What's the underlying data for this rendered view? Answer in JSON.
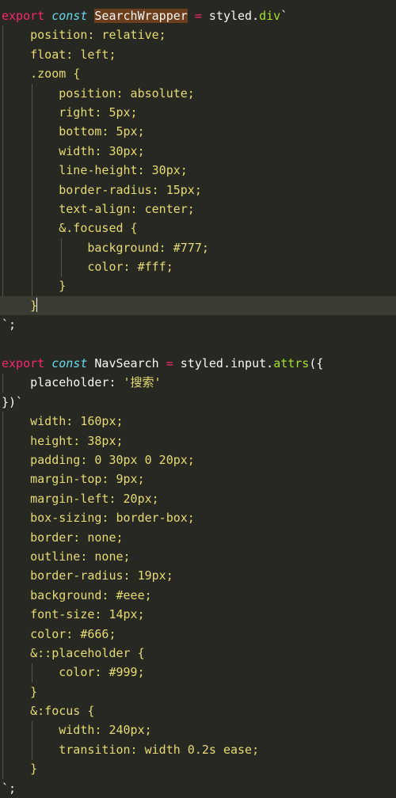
{
  "editor": {
    "theme_name": "monokai",
    "colors": {
      "background": "#272822",
      "active_line": "#3a3b32",
      "keyword": "#f92672",
      "storage": "#66d9ef",
      "string": "#e6db74",
      "function": "#a6e22e",
      "foreground": "#f8f8f2",
      "selection": "#6b3e1e",
      "indent_guide": "#55564f",
      "cursor": "#f8f8f0"
    },
    "cursor_line_index": 15,
    "indent_size": 4,
    "language": "javascript"
  },
  "code": {
    "lines": [
      {
        "indent": 0,
        "active": false,
        "tokens": [
          {
            "t": "export",
            "c": "k"
          },
          {
            "t": " ",
            "c": "pun"
          },
          {
            "t": "const",
            "c": "kc"
          },
          {
            "t": " ",
            "c": "pun"
          },
          {
            "t": "SearchWrapper",
            "c": "sel"
          },
          {
            "t": " ",
            "c": "pun"
          },
          {
            "t": "=",
            "c": "k"
          },
          {
            "t": " ",
            "c": "pun"
          },
          {
            "t": "styled.",
            "c": "id"
          },
          {
            "t": "div",
            "c": "fn"
          },
          {
            "t": "`",
            "c": "pun"
          }
        ]
      },
      {
        "indent": 1,
        "active": false,
        "tokens": [
          {
            "t": "position: relative;",
            "c": "pr"
          }
        ]
      },
      {
        "indent": 1,
        "active": false,
        "tokens": [
          {
            "t": "float: left;",
            "c": "pr"
          }
        ]
      },
      {
        "indent": 1,
        "active": false,
        "tokens": [
          {
            "t": ".zoom {",
            "c": "pr"
          }
        ]
      },
      {
        "indent": 2,
        "active": false,
        "tokens": [
          {
            "t": "position: absolute;",
            "c": "pr"
          }
        ]
      },
      {
        "indent": 2,
        "active": false,
        "tokens": [
          {
            "t": "right: 5px;",
            "c": "pr"
          }
        ]
      },
      {
        "indent": 2,
        "active": false,
        "tokens": [
          {
            "t": "bottom: 5px;",
            "c": "pr"
          }
        ]
      },
      {
        "indent": 2,
        "active": false,
        "tokens": [
          {
            "t": "width: 30px;",
            "c": "pr"
          }
        ]
      },
      {
        "indent": 2,
        "active": false,
        "tokens": [
          {
            "t": "line-height: 30px;",
            "c": "pr"
          }
        ]
      },
      {
        "indent": 2,
        "active": false,
        "tokens": [
          {
            "t": "border-radius: 15px;",
            "c": "pr"
          }
        ]
      },
      {
        "indent": 2,
        "active": false,
        "tokens": [
          {
            "t": "text-align: center;",
            "c": "pr"
          }
        ]
      },
      {
        "indent": 2,
        "active": false,
        "tokens": [
          {
            "t": "&.focused {",
            "c": "pr"
          }
        ]
      },
      {
        "indent": 3,
        "active": false,
        "tokens": [
          {
            "t": "background: #777;",
            "c": "pr"
          }
        ]
      },
      {
        "indent": 3,
        "active": false,
        "tokens": [
          {
            "t": "color: #fff;",
            "c": "pr"
          }
        ]
      },
      {
        "indent": 2,
        "active": false,
        "tokens": [
          {
            "t": "}",
            "c": "pr"
          }
        ]
      },
      {
        "indent": 1,
        "active": true,
        "cursor": true,
        "tokens": [
          {
            "t": "}",
            "c": "pr"
          }
        ]
      },
      {
        "indent": 0,
        "active": false,
        "tokens": [
          {
            "t": "`;",
            "c": "pun"
          }
        ]
      },
      {
        "indent": 0,
        "active": false,
        "tokens": []
      },
      {
        "indent": 0,
        "active": false,
        "tokens": [
          {
            "t": "export",
            "c": "k"
          },
          {
            "t": " ",
            "c": "pun"
          },
          {
            "t": "const",
            "c": "kc"
          },
          {
            "t": " ",
            "c": "pun"
          },
          {
            "t": "NavSearch",
            "c": "id"
          },
          {
            "t": " ",
            "c": "pun"
          },
          {
            "t": "=",
            "c": "k"
          },
          {
            "t": " ",
            "c": "pun"
          },
          {
            "t": "styled.input.",
            "c": "id"
          },
          {
            "t": "attrs",
            "c": "fn"
          },
          {
            "t": "({",
            "c": "pun"
          }
        ]
      },
      {
        "indent": 1,
        "active": false,
        "tokens": [
          {
            "t": "placeholder: ",
            "c": "id"
          },
          {
            "t": "'搜索'",
            "c": "pr"
          }
        ]
      },
      {
        "indent": 0,
        "active": false,
        "tokens": [
          {
            "t": "})`",
            "c": "pun"
          }
        ]
      },
      {
        "indent": 1,
        "active": false,
        "tokens": [
          {
            "t": "width: 160px;",
            "c": "pr"
          }
        ]
      },
      {
        "indent": 1,
        "active": false,
        "tokens": [
          {
            "t": "height: 38px;",
            "c": "pr"
          }
        ]
      },
      {
        "indent": 1,
        "active": false,
        "tokens": [
          {
            "t": "padding: 0 30px 0 20px;",
            "c": "pr"
          }
        ]
      },
      {
        "indent": 1,
        "active": false,
        "tokens": [
          {
            "t": "margin-top: 9px;",
            "c": "pr"
          }
        ]
      },
      {
        "indent": 1,
        "active": false,
        "tokens": [
          {
            "t": "margin-left: 20px;",
            "c": "pr"
          }
        ]
      },
      {
        "indent": 1,
        "active": false,
        "tokens": [
          {
            "t": "box-sizing: border-box;",
            "c": "pr"
          }
        ]
      },
      {
        "indent": 1,
        "active": false,
        "tokens": [
          {
            "t": "border: none;",
            "c": "pr"
          }
        ]
      },
      {
        "indent": 1,
        "active": false,
        "tokens": [
          {
            "t": "outline: none;",
            "c": "pr"
          }
        ]
      },
      {
        "indent": 1,
        "active": false,
        "tokens": [
          {
            "t": "border-radius: 19px;",
            "c": "pr"
          }
        ]
      },
      {
        "indent": 1,
        "active": false,
        "tokens": [
          {
            "t": "background: #eee;",
            "c": "pr"
          }
        ]
      },
      {
        "indent": 1,
        "active": false,
        "tokens": [
          {
            "t": "font-size: 14px;",
            "c": "pr"
          }
        ]
      },
      {
        "indent": 1,
        "active": false,
        "tokens": [
          {
            "t": "color: #666;",
            "c": "pr"
          }
        ]
      },
      {
        "indent": 1,
        "active": false,
        "tokens": [
          {
            "t": "&::placeholder {",
            "c": "pr"
          }
        ]
      },
      {
        "indent": 2,
        "active": false,
        "tokens": [
          {
            "t": "color: #999;",
            "c": "pr"
          }
        ]
      },
      {
        "indent": 1,
        "active": false,
        "tokens": [
          {
            "t": "}",
            "c": "pr"
          }
        ]
      },
      {
        "indent": 1,
        "active": false,
        "tokens": [
          {
            "t": "&:focus {",
            "c": "pr"
          }
        ]
      },
      {
        "indent": 2,
        "active": false,
        "tokens": [
          {
            "t": "width: 240px;",
            "c": "pr"
          }
        ]
      },
      {
        "indent": 2,
        "active": false,
        "tokens": [
          {
            "t": "transition: width 0.2s ease;",
            "c": "pr"
          }
        ]
      },
      {
        "indent": 1,
        "active": false,
        "tokens": [
          {
            "t": "}",
            "c": "pr"
          }
        ]
      },
      {
        "indent": 0,
        "active": false,
        "tokens": [
          {
            "t": "`;",
            "c": "pun"
          }
        ]
      }
    ]
  }
}
